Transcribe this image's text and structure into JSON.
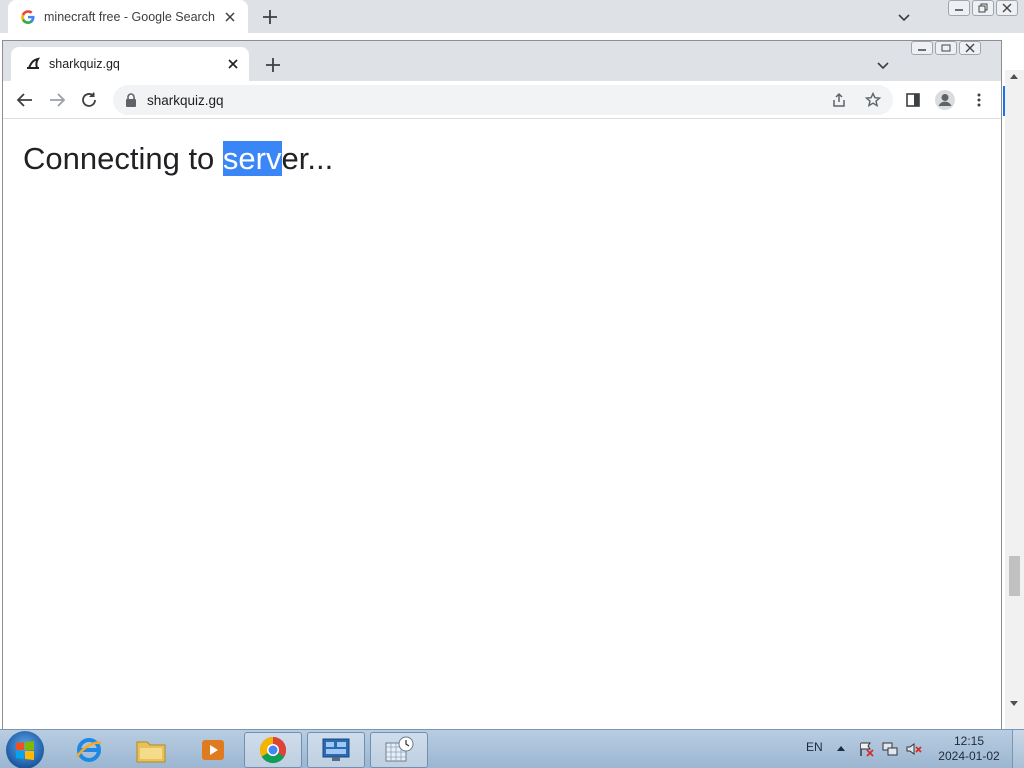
{
  "background_window": {
    "tab_title": "minecraft free - Google Search",
    "favicon": "google-g-icon"
  },
  "browser": {
    "tab_title": "sharkquiz.gq",
    "favicon": "shark-fin-icon",
    "url": "sharkquiz.gq"
  },
  "page": {
    "heading_before": "Connecting to ",
    "heading_selected": "serv",
    "heading_after": "er..."
  },
  "taskbar": {
    "apps": [
      "internet-explorer-icon",
      "file-explorer-icon",
      "media-player-icon",
      "chrome-icon",
      "control-panel-icon",
      "calendar-clock-icon"
    ],
    "active_app": "chrome-icon",
    "language": "EN",
    "time": "12:15",
    "date": "2024-01-02"
  },
  "colors": {
    "selection": "#3b86f7",
    "tab_strip": "#dee1e6",
    "omnibox": "#f1f3f4"
  }
}
